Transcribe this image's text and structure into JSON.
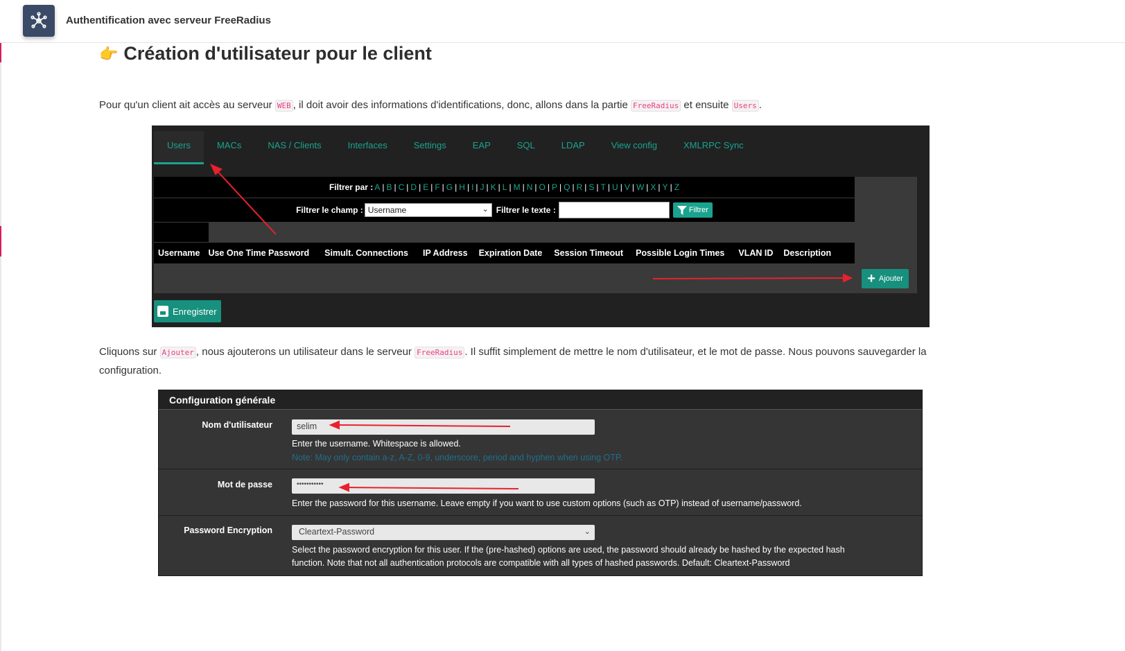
{
  "app": {
    "title": "Authentification avec serveur FreeRadius",
    "logo_icon": "network-nodes-icon"
  },
  "heading": {
    "emoji": "👉",
    "text": "Création d'utilisateur pour le client"
  },
  "para1": {
    "t1": "Pour qu'un client ait accès au serveur ",
    "c1": "WEB",
    "t2": ", il doit avoir des informations d'identifications, donc, allons dans la partie ",
    "c2": "FreeRadius",
    "t3": " et ensuite ",
    "c3": "Users",
    "t4": "."
  },
  "shot1": {
    "tabs": [
      "Users",
      "MACs",
      "NAS / Clients",
      "Interfaces",
      "Settings",
      "EAP",
      "SQL",
      "LDAP",
      "View config",
      "XMLRPC Sync"
    ],
    "active_tab": "Users",
    "filter_by_label": "Filtrer par :",
    "letters": [
      "A",
      "B",
      "C",
      "D",
      "E",
      "F",
      "G",
      "H",
      "I",
      "J",
      "K",
      "L",
      "M",
      "N",
      "O",
      "P",
      "Q",
      "R",
      "S",
      "T",
      "U",
      "V",
      "W",
      "X",
      "Y",
      "Z"
    ],
    "filter_field_label": "Filtrer le champ :",
    "filter_field_value": "Username",
    "filter_text_label": "Filtrer le texte :",
    "filter_button": "Filtrer",
    "columns": [
      "Username",
      "Use One Time Password",
      "Simult. Connections",
      "IP Address",
      "Expiration Date",
      "Session Timeout",
      "Possible Login Times",
      "VLAN ID",
      "Description"
    ],
    "add_button": "Ajouter",
    "save_button": "Enregistrer"
  },
  "para2": {
    "t1": "Cliquons sur ",
    "c1": "Ajouter",
    "t2": ", nous ajouterons un utilisateur dans le serveur ",
    "c2": "FreeRadius",
    "t3": ". Il suffit simplement de mettre le nom d'utilisateur, et le mot de passe. Nous pouvons sauvegarder la",
    "t4": "configuration."
  },
  "shot2": {
    "header": "Configuration générale",
    "username_label": "Nom d'utilisateur",
    "username_value": "selim",
    "username_help": "Enter the username. Whitespace is allowed.",
    "username_note": "Note: May only contain a-z, A-Z, 0-9, underscore, period and hyphen when using OTP.",
    "password_label": "Mot de passe",
    "password_value": "•••••••••••",
    "password_help": "Enter the password for this username. Leave empty if you want to use custom options (such as OTP) instead of username/password.",
    "encryption_label": "Password Encryption",
    "encryption_value": "Cleartext-Password",
    "encryption_help1": "Select the password encryption for this user. If the (pre-hashed) options are used, the password should already be hashed by the expected hash",
    "encryption_help2": "function. Note that not all authentication protocols are compatible with all types of hashed passwords. Default: Cleartext-Password"
  },
  "colors": {
    "accent": "#1aa38f",
    "button": "#17907e",
    "annotation": "#e8212e"
  }
}
